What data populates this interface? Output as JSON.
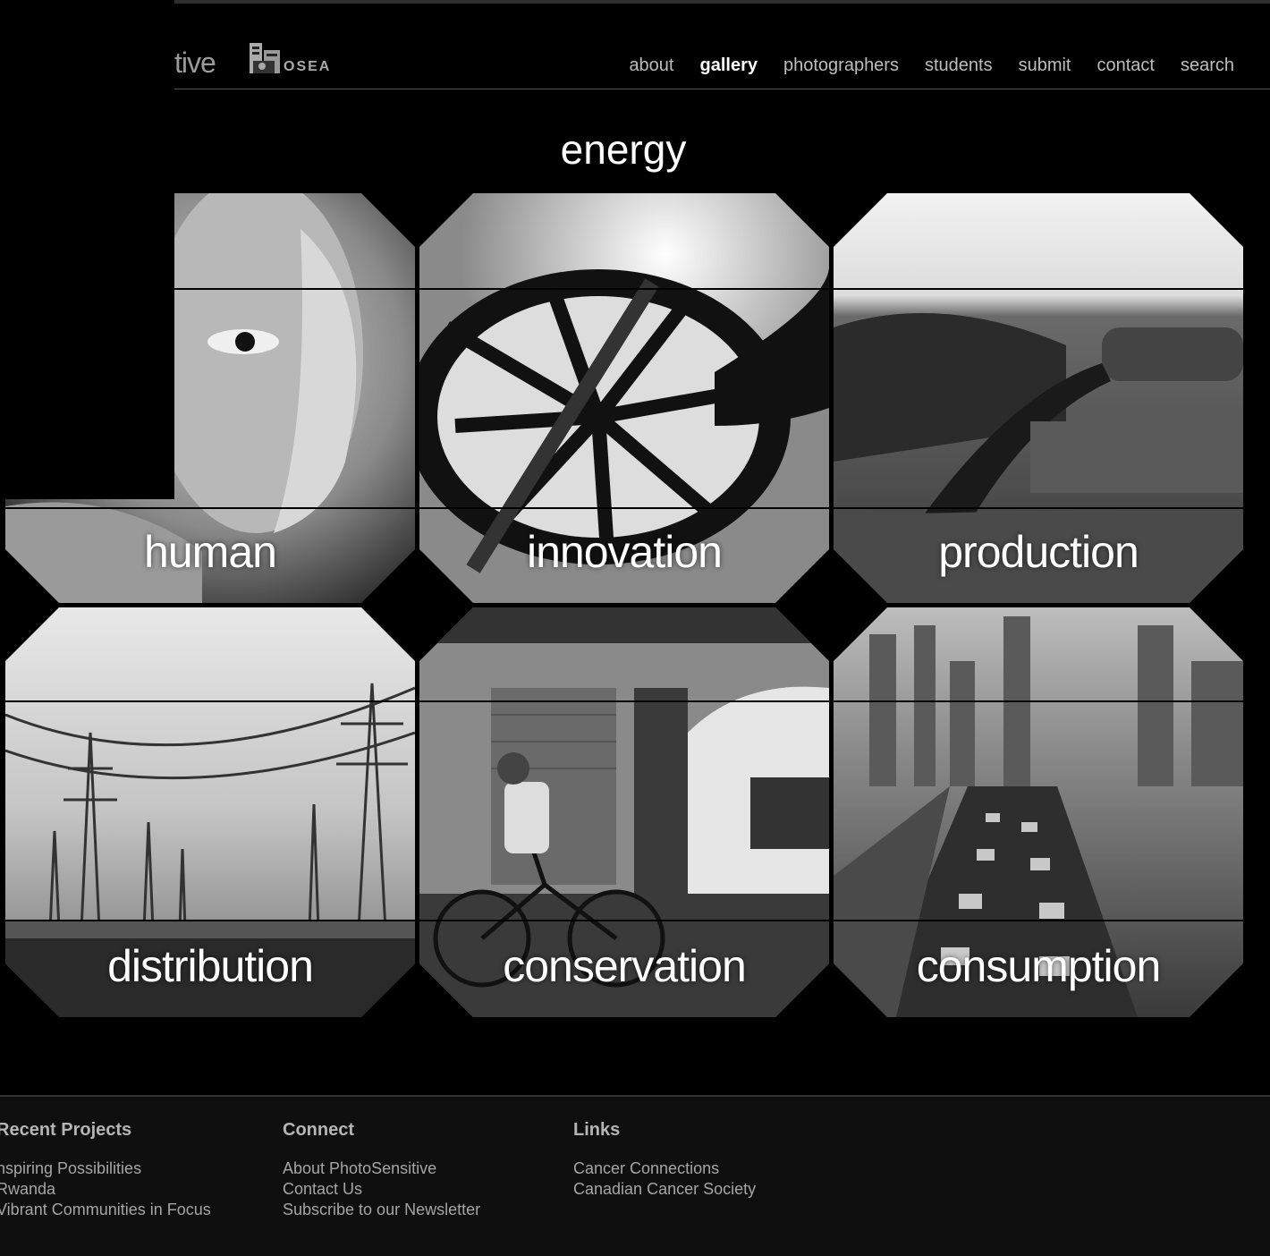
{
  "header": {
    "brand_text": "tive",
    "logo_text": "OSEA"
  },
  "nav": {
    "items": [
      {
        "label": "about"
      },
      {
        "label": "gallery",
        "active": true
      },
      {
        "label": "photographers"
      },
      {
        "label": "students"
      },
      {
        "label": "submit"
      },
      {
        "label": "contact"
      },
      {
        "label": "search"
      }
    ]
  },
  "gallery": {
    "title": "energy",
    "tiles": [
      {
        "label": "human"
      },
      {
        "label": "innovation"
      },
      {
        "label": "production"
      },
      {
        "label": "distribution"
      },
      {
        "label": "conservation"
      },
      {
        "label": "consumption"
      }
    ]
  },
  "footer": {
    "recent_projects": {
      "heading": "Recent Projects",
      "links": [
        "nspiring Possibilities",
        "Rwanda",
        "Vibrant Communities in Focus"
      ]
    },
    "connect": {
      "heading": "Connect",
      "links": [
        "About PhotoSensitive",
        "Contact Us",
        "Subscribe to our Newsletter"
      ]
    },
    "links": {
      "heading": "Links",
      "links": [
        "Cancer Connections",
        "Canadian Cancer Society"
      ]
    }
  },
  "colors": {
    "background": "#000000",
    "footer_bg": "#0f0f0f",
    "nav_text": "#bdbdbd",
    "nav_active": "#ffffff"
  }
}
